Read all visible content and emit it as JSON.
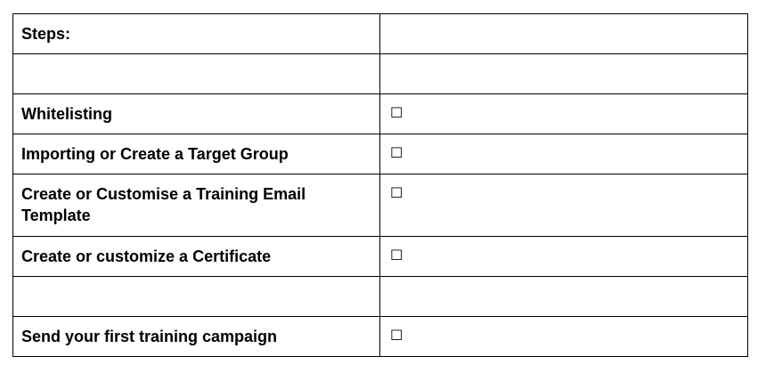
{
  "table": {
    "rows": [
      {
        "step": "Steps:",
        "check": ""
      },
      {
        "step": "",
        "check": ""
      },
      {
        "step": "Whitelisting",
        "check": "☐"
      },
      {
        "step": "Importing or Create a Target Group",
        "check": "☐"
      },
      {
        "step": "Create or Customise a Training Email Template",
        "check": "☐"
      },
      {
        "step": "Create or customize a Certificate",
        "check": "☐"
      },
      {
        "step": "",
        "check": ""
      },
      {
        "step": "Send your first training campaign",
        "check": "☐"
      }
    ]
  }
}
